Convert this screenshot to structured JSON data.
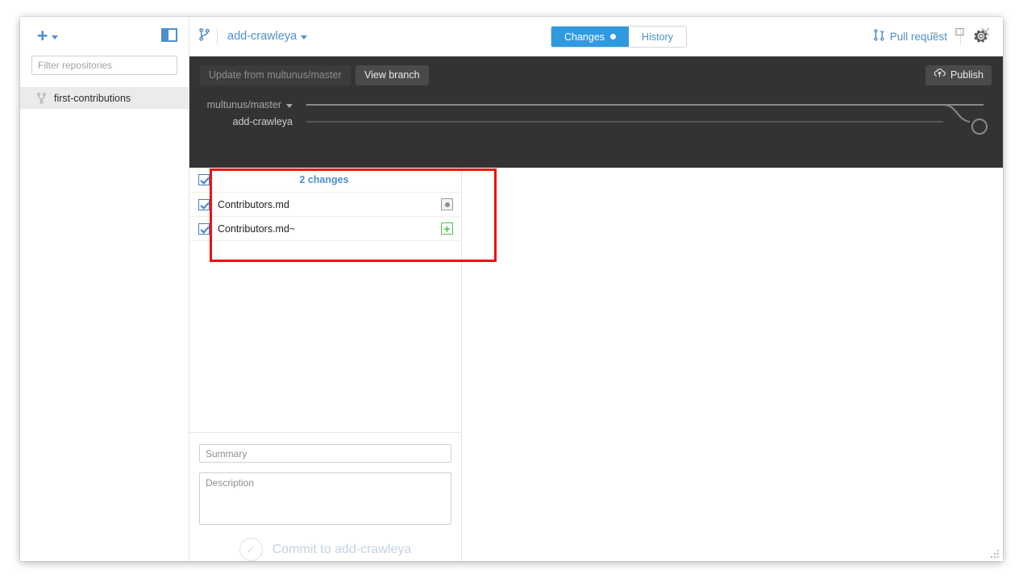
{
  "window": {
    "controls": {
      "minimize": "—",
      "maximize": "☐",
      "close": "✕"
    }
  },
  "sidebar": {
    "add_repository_label": "+",
    "toggle_name": "sidebar-toggle-icon",
    "filter": {
      "placeholder": "Filter repositories",
      "value": ""
    },
    "repositories": [
      {
        "name": "first-contributions",
        "icon": "branch-icon",
        "selected": true
      }
    ]
  },
  "header": {
    "branch_icon": "branch-icon",
    "current_branch": "add-crawleya",
    "tabs": [
      {
        "label": "Changes",
        "active": true,
        "has_dot": true
      },
      {
        "label": "History",
        "active": false,
        "has_dot": false
      }
    ],
    "pull_request_label": "Pull request",
    "pull_request_icon": "pull-request-icon",
    "settings_icon": "gear-icon"
  },
  "branch_bar": {
    "update_button": "Update from multunus/master",
    "view_branch_button": "View branch",
    "publish_button": "Publish",
    "publish_icon": "publish-cloud-icon",
    "base_branch": "multunus/master",
    "head_branch": "add-crawleya"
  },
  "changes": {
    "count_label": "2 changes",
    "all_checked": true,
    "files": [
      {
        "name": "Contributors.md",
        "checked": true,
        "status": "modified",
        "status_icon": "modified-dot-icon"
      },
      {
        "name": "Contributors.md~",
        "checked": true,
        "status": "new",
        "status_icon": "new-file-plus-icon"
      }
    ]
  },
  "commit": {
    "summary_placeholder": "Summary",
    "summary_value": "",
    "description_placeholder": "Description",
    "description_value": "",
    "button_label": "Commit to add-crawleya",
    "button_icon": "check-circle-icon",
    "button_enabled": false
  },
  "colors": {
    "accent_blue": "#4d8fcc",
    "tab_active_blue": "#2f9ae0",
    "dark_bar": "#333333",
    "annotation_red": "#ee1111",
    "new_file_green": "#4cc44c"
  }
}
